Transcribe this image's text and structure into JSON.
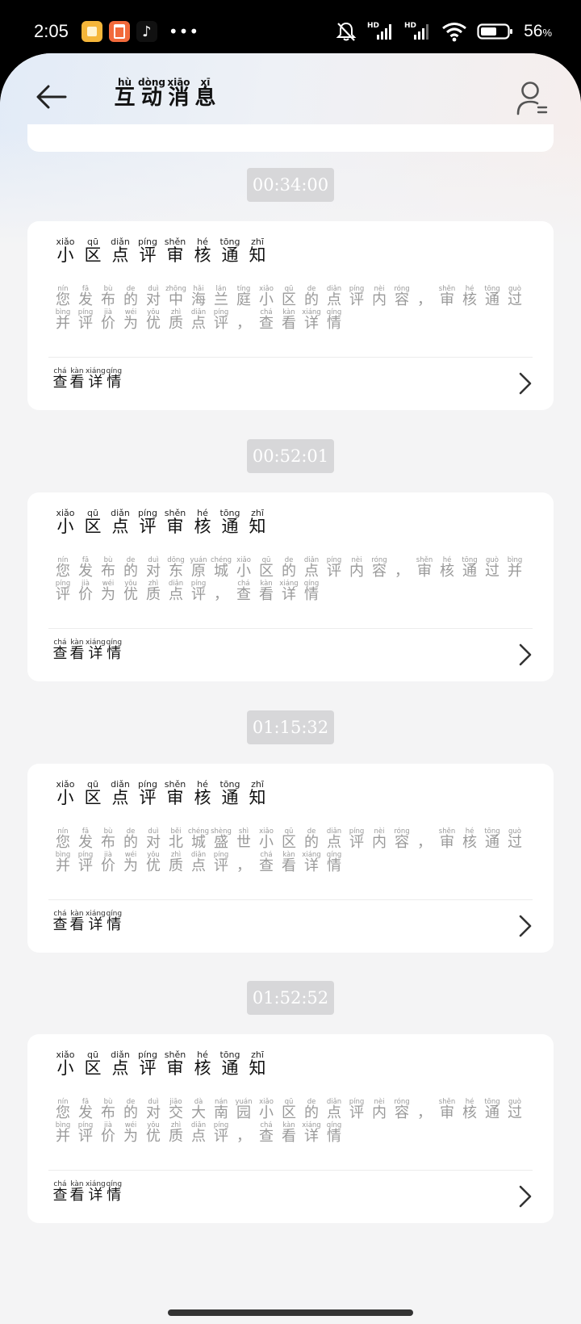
{
  "status_bar": {
    "time": "2:05",
    "more_icon": "•••",
    "battery_percent": "56",
    "battery_unit": "%",
    "icons": [
      "notes-app-icon",
      "orange-app-icon",
      "tiktok-icon",
      "bell-off-icon",
      "hd-signal-icon",
      "hd-signal-icon",
      "wifi-icon",
      "battery-icon"
    ]
  },
  "header": {
    "title": [
      {
        "py": "hù",
        "hz": "互"
      },
      {
        "py": "dòng",
        "hz": "动"
      },
      {
        "py": "xiāo",
        "hz": "消"
      },
      {
        "py": "xī",
        "hz": "息"
      }
    ]
  },
  "messages": [
    {
      "time": "00:34:00",
      "title": [
        {
          "py": "xiǎo",
          "hz": "小"
        },
        {
          "py": "qū",
          "hz": "区"
        },
        {
          "py": "diǎn",
          "hz": "点"
        },
        {
          "py": "píng",
          "hz": "评"
        },
        {
          "py": "shěn",
          "hz": "审"
        },
        {
          "py": "hé",
          "hz": "核"
        },
        {
          "py": "tōng",
          "hz": "通"
        },
        {
          "py": "zhī",
          "hz": "知"
        }
      ],
      "body": [
        {
          "py": "nín",
          "hz": "您"
        },
        {
          "py": "fā",
          "hz": "发"
        },
        {
          "py": "bù",
          "hz": "布"
        },
        {
          "py": "de",
          "hz": "的"
        },
        {
          "py": "duì",
          "hz": "对"
        },
        {
          "py": "zhōng",
          "hz": "中"
        },
        {
          "py": "hǎi",
          "hz": "海"
        },
        {
          "py": "lán",
          "hz": "兰"
        },
        {
          "py": "tíng",
          "hz": "庭"
        },
        {
          "py": "xiǎo",
          "hz": "小"
        },
        {
          "py": "qū",
          "hz": "区"
        },
        {
          "py": "de",
          "hz": "的"
        },
        {
          "py": "diǎn",
          "hz": "点"
        },
        {
          "py": "píng",
          "hz": "评"
        },
        {
          "py": "nèi",
          "hz": "内"
        },
        {
          "py": "róng",
          "hz": "容"
        },
        {
          "py": "",
          "hz": "，"
        },
        {
          "py": "shěn",
          "hz": "审"
        },
        {
          "py": "hé",
          "hz": "核"
        },
        {
          "py": "tōng",
          "hz": "通"
        },
        {
          "py": "guò",
          "hz": "过"
        },
        {
          "py": "bìng",
          "hz": "并"
        },
        {
          "py": "píng",
          "hz": "评"
        },
        {
          "py": "jià",
          "hz": "价"
        },
        {
          "py": "wéi",
          "hz": "为"
        },
        {
          "py": "yōu",
          "hz": "优"
        },
        {
          "py": "zhì",
          "hz": "质"
        },
        {
          "py": "diǎn",
          "hz": "点"
        },
        {
          "py": "píng",
          "hz": "评"
        },
        {
          "py": "",
          "hz": "，"
        },
        {
          "py": "chá",
          "hz": "查"
        },
        {
          "py": "kàn",
          "hz": "看"
        },
        {
          "py": "xiáng",
          "hz": "详"
        },
        {
          "py": "qíng",
          "hz": "情"
        }
      ],
      "footer": [
        {
          "py": "chá",
          "hz": "查"
        },
        {
          "py": "kàn",
          "hz": "看"
        },
        {
          "py": "xiáng",
          "hz": "详"
        },
        {
          "py": "qíng",
          "hz": "情"
        }
      ]
    },
    {
      "time": "00:52:01",
      "title": [
        {
          "py": "xiǎo",
          "hz": "小"
        },
        {
          "py": "qū",
          "hz": "区"
        },
        {
          "py": "diǎn",
          "hz": "点"
        },
        {
          "py": "píng",
          "hz": "评"
        },
        {
          "py": "shěn",
          "hz": "审"
        },
        {
          "py": "hé",
          "hz": "核"
        },
        {
          "py": "tōng",
          "hz": "通"
        },
        {
          "py": "zhī",
          "hz": "知"
        }
      ],
      "body": [
        {
          "py": "nín",
          "hz": "您"
        },
        {
          "py": "fā",
          "hz": "发"
        },
        {
          "py": "bù",
          "hz": "布"
        },
        {
          "py": "de",
          "hz": "的"
        },
        {
          "py": "duì",
          "hz": "对"
        },
        {
          "py": "dōng",
          "hz": "东"
        },
        {
          "py": "yuán",
          "hz": "原"
        },
        {
          "py": "chéng",
          "hz": "城"
        },
        {
          "py": "xiǎo",
          "hz": "小"
        },
        {
          "py": "qū",
          "hz": "区"
        },
        {
          "py": "de",
          "hz": "的"
        },
        {
          "py": "diǎn",
          "hz": "点"
        },
        {
          "py": "píng",
          "hz": "评"
        },
        {
          "py": "nèi",
          "hz": "内"
        },
        {
          "py": "róng",
          "hz": "容"
        },
        {
          "py": "",
          "hz": "，"
        },
        {
          "py": "shěn",
          "hz": "审"
        },
        {
          "py": "hé",
          "hz": "核"
        },
        {
          "py": "tōng",
          "hz": "通"
        },
        {
          "py": "guò",
          "hz": "过"
        },
        {
          "py": "bìng",
          "hz": "并"
        },
        {
          "py": "píng",
          "hz": "评"
        },
        {
          "py": "jià",
          "hz": "价"
        },
        {
          "py": "wéi",
          "hz": "为"
        },
        {
          "py": "yōu",
          "hz": "优"
        },
        {
          "py": "zhì",
          "hz": "质"
        },
        {
          "py": "diǎn",
          "hz": "点"
        },
        {
          "py": "píng",
          "hz": "评"
        },
        {
          "py": "",
          "hz": "，"
        },
        {
          "py": "chá",
          "hz": "查"
        },
        {
          "py": "kàn",
          "hz": "看"
        },
        {
          "py": "xiáng",
          "hz": "详"
        },
        {
          "py": "qíng",
          "hz": "情"
        }
      ],
      "footer": [
        {
          "py": "chá",
          "hz": "查"
        },
        {
          "py": "kàn",
          "hz": "看"
        },
        {
          "py": "xiáng",
          "hz": "详"
        },
        {
          "py": "qíng",
          "hz": "情"
        }
      ]
    },
    {
      "time": "01:15:32",
      "title": [
        {
          "py": "xiǎo",
          "hz": "小"
        },
        {
          "py": "qū",
          "hz": "区"
        },
        {
          "py": "diǎn",
          "hz": "点"
        },
        {
          "py": "píng",
          "hz": "评"
        },
        {
          "py": "shěn",
          "hz": "审"
        },
        {
          "py": "hé",
          "hz": "核"
        },
        {
          "py": "tōng",
          "hz": "通"
        },
        {
          "py": "zhī",
          "hz": "知"
        }
      ],
      "body": [
        {
          "py": "nín",
          "hz": "您"
        },
        {
          "py": "fā",
          "hz": "发"
        },
        {
          "py": "bù",
          "hz": "布"
        },
        {
          "py": "de",
          "hz": "的"
        },
        {
          "py": "duì",
          "hz": "对"
        },
        {
          "py": "běi",
          "hz": "北"
        },
        {
          "py": "chéng",
          "hz": "城"
        },
        {
          "py": "shèng",
          "hz": "盛"
        },
        {
          "py": "shì",
          "hz": "世"
        },
        {
          "py": "xiǎo",
          "hz": "小"
        },
        {
          "py": "qū",
          "hz": "区"
        },
        {
          "py": "de",
          "hz": "的"
        },
        {
          "py": "diǎn",
          "hz": "点"
        },
        {
          "py": "píng",
          "hz": "评"
        },
        {
          "py": "nèi",
          "hz": "内"
        },
        {
          "py": "róng",
          "hz": "容"
        },
        {
          "py": "",
          "hz": "，"
        },
        {
          "py": "shěn",
          "hz": "审"
        },
        {
          "py": "hé",
          "hz": "核"
        },
        {
          "py": "tōng",
          "hz": "通"
        },
        {
          "py": "guò",
          "hz": "过"
        },
        {
          "py": "bìng",
          "hz": "并"
        },
        {
          "py": "píng",
          "hz": "评"
        },
        {
          "py": "jià",
          "hz": "价"
        },
        {
          "py": "wéi",
          "hz": "为"
        },
        {
          "py": "yōu",
          "hz": "优"
        },
        {
          "py": "zhì",
          "hz": "质"
        },
        {
          "py": "diǎn",
          "hz": "点"
        },
        {
          "py": "píng",
          "hz": "评"
        },
        {
          "py": "",
          "hz": "，"
        },
        {
          "py": "chá",
          "hz": "查"
        },
        {
          "py": "kàn",
          "hz": "看"
        },
        {
          "py": "xiáng",
          "hz": "详"
        },
        {
          "py": "qíng",
          "hz": "情"
        }
      ],
      "footer": [
        {
          "py": "chá",
          "hz": "查"
        },
        {
          "py": "kàn",
          "hz": "看"
        },
        {
          "py": "xiáng",
          "hz": "详"
        },
        {
          "py": "qíng",
          "hz": "情"
        }
      ]
    },
    {
      "time": "01:52:52",
      "title": [
        {
          "py": "xiǎo",
          "hz": "小"
        },
        {
          "py": "qū",
          "hz": "区"
        },
        {
          "py": "diǎn",
          "hz": "点"
        },
        {
          "py": "píng",
          "hz": "评"
        },
        {
          "py": "shěn",
          "hz": "审"
        },
        {
          "py": "hé",
          "hz": "核"
        },
        {
          "py": "tōng",
          "hz": "通"
        },
        {
          "py": "zhī",
          "hz": "知"
        }
      ],
      "body": [
        {
          "py": "nín",
          "hz": "您"
        },
        {
          "py": "fā",
          "hz": "发"
        },
        {
          "py": "bù",
          "hz": "布"
        },
        {
          "py": "de",
          "hz": "的"
        },
        {
          "py": "duì",
          "hz": "对"
        },
        {
          "py": "jiāo",
          "hz": "交"
        },
        {
          "py": "dà",
          "hz": "大"
        },
        {
          "py": "nán",
          "hz": "南"
        },
        {
          "py": "yuán",
          "hz": "园"
        },
        {
          "py": "xiǎo",
          "hz": "小"
        },
        {
          "py": "qū",
          "hz": "区"
        },
        {
          "py": "de",
          "hz": "的"
        },
        {
          "py": "diǎn",
          "hz": "点"
        },
        {
          "py": "píng",
          "hz": "评"
        },
        {
          "py": "nèi",
          "hz": "内"
        },
        {
          "py": "róng",
          "hz": "容"
        },
        {
          "py": "",
          "hz": "，"
        },
        {
          "py": "shěn",
          "hz": "审"
        },
        {
          "py": "hé",
          "hz": "核"
        },
        {
          "py": "tōng",
          "hz": "通"
        },
        {
          "py": "guò",
          "hz": "过"
        },
        {
          "py": "bìng",
          "hz": "并"
        },
        {
          "py": "píng",
          "hz": "评"
        },
        {
          "py": "jià",
          "hz": "价"
        },
        {
          "py": "wéi",
          "hz": "为"
        },
        {
          "py": "yōu",
          "hz": "优"
        },
        {
          "py": "zhì",
          "hz": "质"
        },
        {
          "py": "diǎn",
          "hz": "点"
        },
        {
          "py": "píng",
          "hz": "评"
        },
        {
          "py": "",
          "hz": "，"
        },
        {
          "py": "chá",
          "hz": "查"
        },
        {
          "py": "kàn",
          "hz": "看"
        },
        {
          "py": "xiáng",
          "hz": "详"
        },
        {
          "py": "qíng",
          "hz": "情"
        }
      ],
      "footer": [
        {
          "py": "chá",
          "hz": "查"
        },
        {
          "py": "kàn",
          "hz": "看"
        },
        {
          "py": "xiáng",
          "hz": "详"
        },
        {
          "py": "qíng",
          "hz": "情"
        }
      ]
    }
  ]
}
